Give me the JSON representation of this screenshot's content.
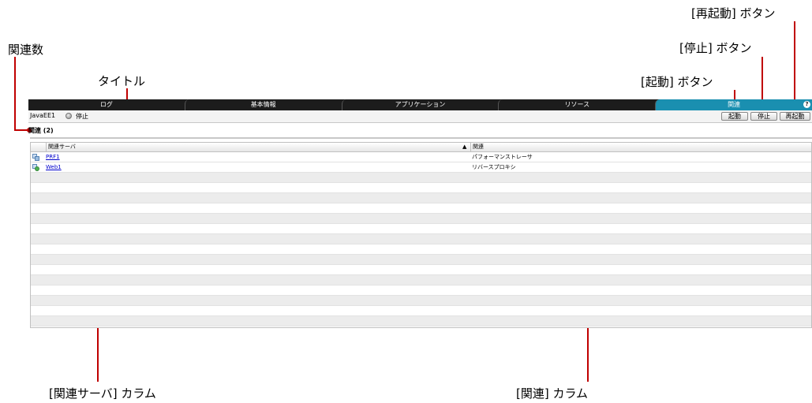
{
  "callouts": {
    "kanren_count": "関連数",
    "title": "タイトル",
    "start_btn": "[起動] ボタン",
    "stop_btn": "[停止] ボタン",
    "restart_btn": "[再起動] ボタン",
    "server_col": "[関連サーバ] カラム",
    "rel_col": "[関連] カラム"
  },
  "tabs": [
    {
      "label": "ログ"
    },
    {
      "label": "基本情報"
    },
    {
      "label": "アプリケーション"
    },
    {
      "label": "リソース"
    },
    {
      "label": "関連"
    }
  ],
  "help_icon": "?",
  "title_row": {
    "name": "JavaEE1",
    "status": "停止",
    "buttons": {
      "start": "起動",
      "stop": "停止",
      "restart": "再起動"
    }
  },
  "related_header": "関連 (2)",
  "table": {
    "columns": [
      "関連サーバ",
      "関連"
    ],
    "sort_indicator": "▲",
    "rows": [
      {
        "server": "PRF1",
        "relation": "パフォーマンストレーサ",
        "icon": "prf-server-icon"
      },
      {
        "server": "Web1",
        "relation": "リバースプロキシ",
        "icon": "web-server-icon"
      }
    ]
  },
  "colors": {
    "accent": "#c00000",
    "tab_active": "#1a8fb0",
    "tab_bg": "#1c1c1c",
    "link": "#0000cc"
  }
}
